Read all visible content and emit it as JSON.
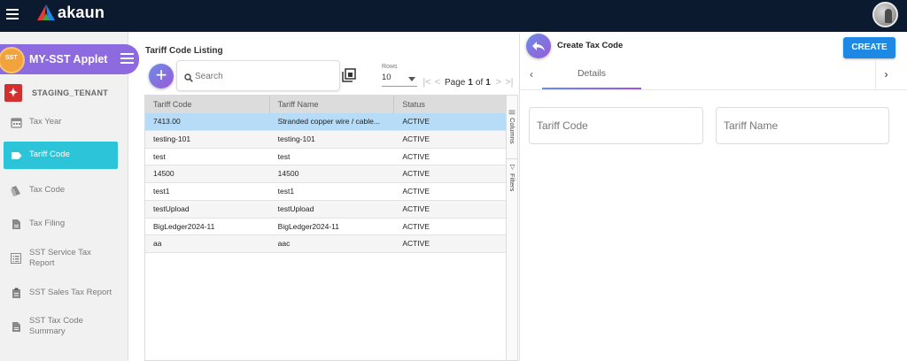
{
  "app": {
    "logo_text": "akaun",
    "applet_name": "MY-SST Applet",
    "applet_badge": "SST",
    "tenant": "STAGING_TENANT"
  },
  "sidebar": {
    "items": [
      {
        "label": "Tax Year",
        "icon": "calendar-icon"
      },
      {
        "label": "Tariff Code",
        "icon": "tag-icon",
        "active": true
      },
      {
        "label": "Tax Code",
        "icon": "price-tags-icon"
      },
      {
        "label": "Tax Filing",
        "icon": "document-icon"
      },
      {
        "label": "SST Service Tax Report",
        "icon": "list-report-icon"
      },
      {
        "label": "SST Sales Tax Report",
        "icon": "clipboard-icon"
      },
      {
        "label": "SST Tax Code Summary",
        "icon": "document-icon"
      }
    ]
  },
  "listing": {
    "title": "Tariff Code Listing",
    "search_placeholder": "Search",
    "rows_label": "Rows",
    "rows_value": "10",
    "page_label": "Page",
    "page_current": "1",
    "page_of": "of",
    "page_total": "1",
    "columns": [
      "Tariff Code",
      "Tariff Name",
      "Status"
    ],
    "rows": [
      {
        "code": "7413.00",
        "name": "Stranded copper wire / cable...",
        "status": "ACTIVE",
        "selected": true
      },
      {
        "code": "testing-101",
        "name": "testing-101",
        "status": "ACTIVE"
      },
      {
        "code": "test",
        "name": "test",
        "status": "ACTIVE"
      },
      {
        "code": "14500",
        "name": "14500",
        "status": "ACTIVE"
      },
      {
        "code": "test1",
        "name": "test1",
        "status": "ACTIVE"
      },
      {
        "code": "testUpload",
        "name": "testUpload",
        "status": "ACTIVE"
      },
      {
        "code": "BigLedger2024-11",
        "name": "BigLedger2024-11",
        "status": "ACTIVE"
      },
      {
        "code": "aa",
        "name": "aac",
        "status": "ACTIVE"
      }
    ],
    "side_tabs": {
      "columns": "Columns",
      "filters": "Filters"
    }
  },
  "panel": {
    "title": "Create Tax Code",
    "create_label": "CREATE",
    "tab_details": "Details",
    "field_tariff_code": "Tariff Code",
    "field_tariff_name": "Tariff Name"
  },
  "colors": {
    "topbar": "#0b1a2e",
    "applet_purple": "#8e6ae0",
    "active_nav": "#2bc4d8",
    "create_button": "#1e88e5",
    "selected_row": "#b6dcf7"
  }
}
